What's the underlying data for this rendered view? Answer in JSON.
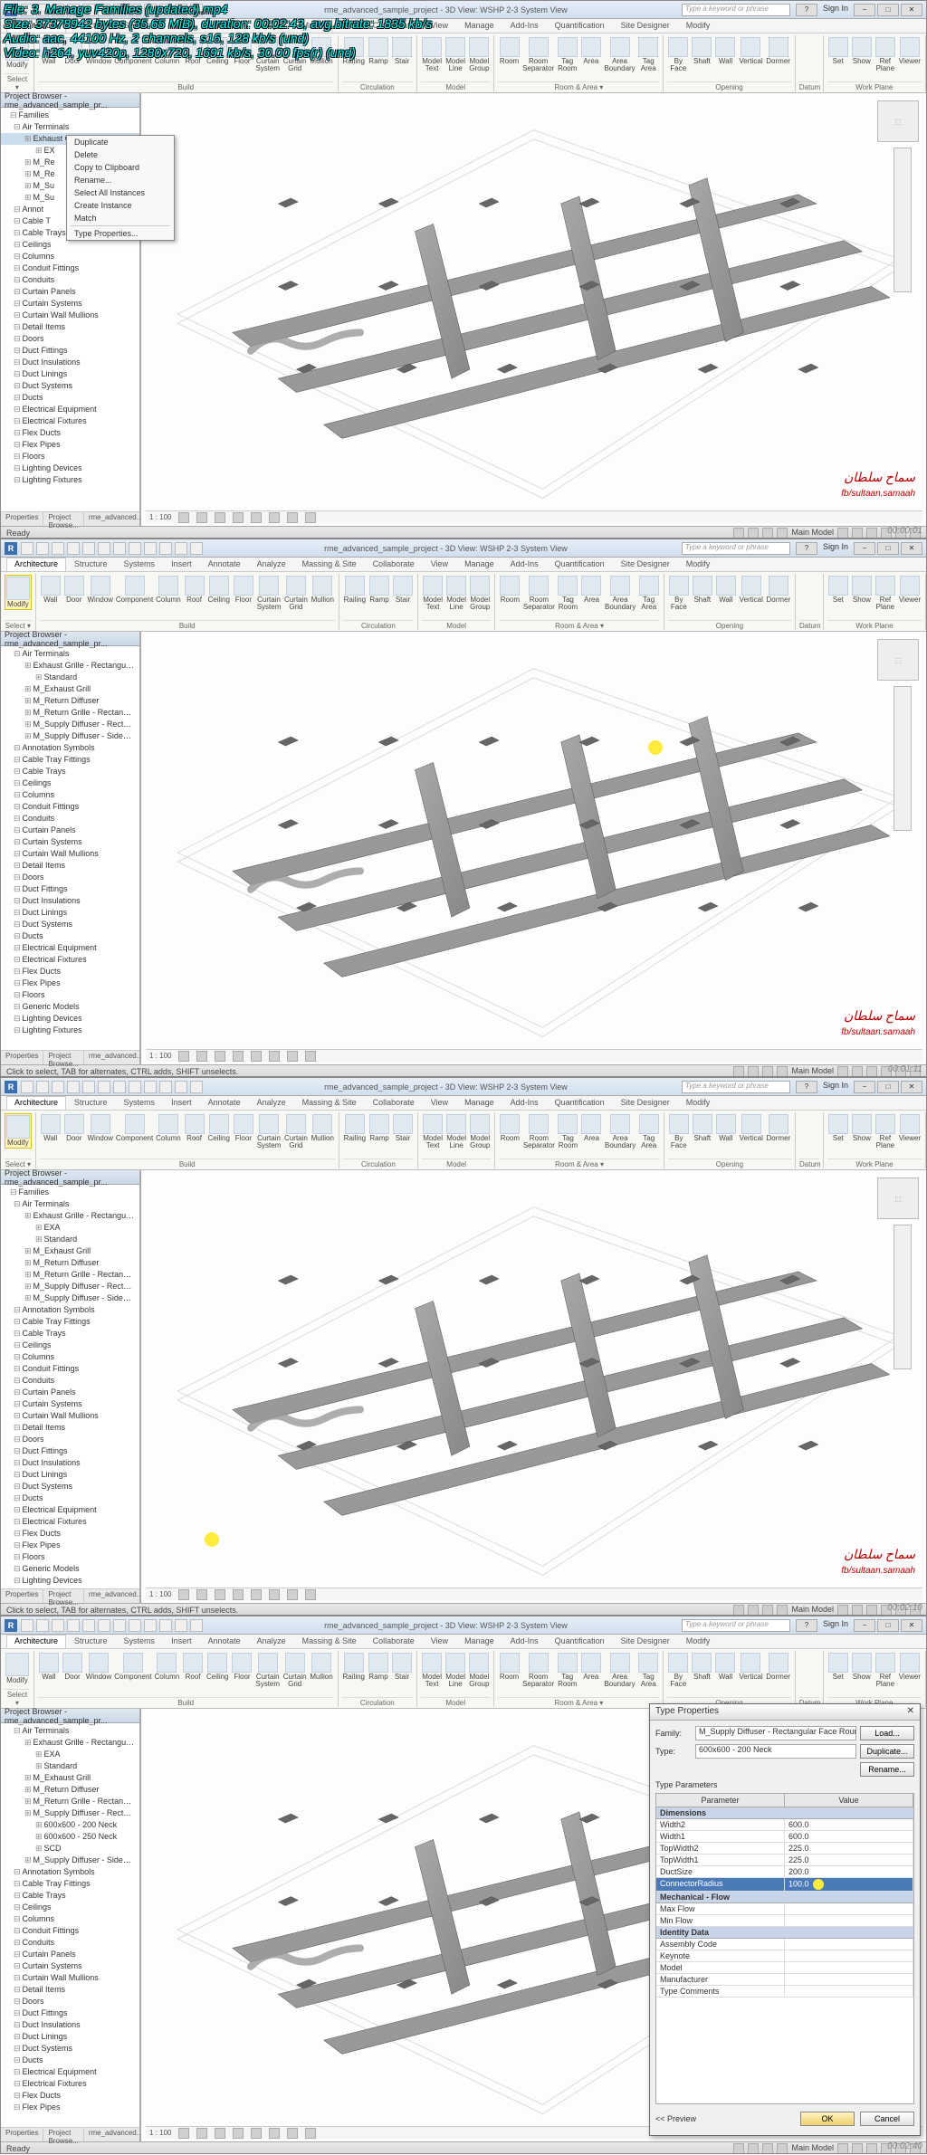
{
  "overlay": {
    "file": "File: 3. Manage Families (updated).mp4",
    "size": "Size: 37378942 bytes (35.65 MiB), duration: 00:02:43, avg.bitrate: 1835 kb/s",
    "audio": "Audio: aac, 44100 Hz, 2 channels, s16, 128 kb/s (und)",
    "video": "Video: h264, yuv420p, 1280x720, 1691 kb/s, 30.00 fps(r) (und)"
  },
  "title_text": "rme_advanced_sample_project - 3D View: WSHP 2-3 System View",
  "search_placeholder": "Type a keyword or phrase",
  "sign_in": "Sign In",
  "ribbon_tabs": [
    "Architecture",
    "Structure",
    "Systems",
    "Insert",
    "Annotate",
    "Analyze",
    "Massing & Site",
    "Collaborate",
    "View",
    "Manage",
    "Add-Ins",
    "Quantification",
    "Site Designer",
    "Modify"
  ],
  "ribbon_groups": {
    "select": {
      "label": "Select ▾",
      "items": [
        {
          "label": "Modify"
        }
      ]
    },
    "build": {
      "label": "Build",
      "items": [
        {
          "label": "Wall"
        },
        {
          "label": "Door"
        },
        {
          "label": "Window"
        },
        {
          "label": "Component"
        },
        {
          "label": "Column"
        },
        {
          "label": "Roof"
        },
        {
          "label": "Ceiling"
        },
        {
          "label": "Floor"
        },
        {
          "label": "Curtain\nSystem"
        },
        {
          "label": "Curtain\nGrid"
        },
        {
          "label": "Mullion"
        }
      ]
    },
    "circulation": {
      "label": "Circulation",
      "items": [
        {
          "label": "Railing"
        },
        {
          "label": "Ramp"
        },
        {
          "label": "Stair"
        }
      ]
    },
    "model": {
      "label": "Model",
      "items": [
        {
          "label": "Model\nText"
        },
        {
          "label": "Model\nLine"
        },
        {
          "label": "Model\nGroup"
        }
      ]
    },
    "room": {
      "label": "Room & Area ▾",
      "items": [
        {
          "label": "Room"
        },
        {
          "label": "Room\nSeparator"
        },
        {
          "label": "Tag\nRoom"
        },
        {
          "label": "Area"
        },
        {
          "label": "Area\nBoundary"
        },
        {
          "label": "Tag\nArea"
        }
      ]
    },
    "opening": {
      "label": "Opening",
      "items": [
        {
          "label": "By\nFace"
        },
        {
          "label": "Shaft"
        },
        {
          "label": "Wall"
        },
        {
          "label": "Vertical"
        },
        {
          "label": "Dormer"
        }
      ]
    },
    "datum": {
      "label": "Datum"
    },
    "workplane": {
      "label": "Work Plane",
      "items": [
        {
          "label": "Set"
        },
        {
          "label": "Show"
        },
        {
          "label": "Ref\nPlane"
        },
        {
          "label": "Viewer"
        }
      ]
    }
  },
  "project_browser_title": "Project Browser - rme_advanced_sample_pr...",
  "panel_tabs": [
    "Properties",
    "Project Browse...",
    "rme_advanced..."
  ],
  "tree1": [
    {
      "l": 0,
      "t": "Families"
    },
    {
      "l": 1,
      "t": "Air Terminals"
    },
    {
      "l": 2,
      "t": "Exhaust Grille - Rectangular - F",
      "sel": true
    },
    {
      "l": 3,
      "t": "EX"
    },
    {
      "l": 2,
      "t": "M_Re"
    },
    {
      "l": 2,
      "t": "M_Re"
    },
    {
      "l": 2,
      "t": "M_Su"
    },
    {
      "l": 2,
      "t": "M_Su"
    },
    {
      "l": 1,
      "t": "Annot"
    },
    {
      "l": 1,
      "t": "Cable T"
    },
    {
      "l": 1,
      "t": "Cable Trays"
    },
    {
      "l": 1,
      "t": "Ceilings"
    },
    {
      "l": 1,
      "t": "Columns"
    },
    {
      "l": 1,
      "t": "Conduit Fittings"
    },
    {
      "l": 1,
      "t": "Conduits"
    },
    {
      "l": 1,
      "t": "Curtain Panels"
    },
    {
      "l": 1,
      "t": "Curtain Systems"
    },
    {
      "l": 1,
      "t": "Curtain Wall Mullions"
    },
    {
      "l": 1,
      "t": "Detail Items"
    },
    {
      "l": 1,
      "t": "Doors"
    },
    {
      "l": 1,
      "t": "Duct Fittings"
    },
    {
      "l": 1,
      "t": "Duct Insulations"
    },
    {
      "l": 1,
      "t": "Duct Linings"
    },
    {
      "l": 1,
      "t": "Duct Systems"
    },
    {
      "l": 1,
      "t": "Ducts"
    },
    {
      "l": 1,
      "t": "Electrical Equipment"
    },
    {
      "l": 1,
      "t": "Electrical Fixtures"
    },
    {
      "l": 1,
      "t": "Flex Ducts"
    },
    {
      "l": 1,
      "t": "Flex Pipes"
    },
    {
      "l": 1,
      "t": "Floors"
    },
    {
      "l": 1,
      "t": "Lighting Devices"
    },
    {
      "l": 1,
      "t": "Lighting Fixtures"
    }
  ],
  "tree2": [
    {
      "l": 1,
      "t": "Air Terminals"
    },
    {
      "l": 2,
      "t": "Exhaust Grille - Rectangular - F"
    },
    {
      "l": 3,
      "t": "Standard"
    },
    {
      "l": 2,
      "t": "M_Exhaust Grill"
    },
    {
      "l": 2,
      "t": "M_Return Diffuser"
    },
    {
      "l": 2,
      "t": "M_Return Grille - Rectangular -"
    },
    {
      "l": 2,
      "t": "M_Supply Diffuser - Rectangul"
    },
    {
      "l": 2,
      "t": "M_Supply Diffuser - Sidewall"
    },
    {
      "l": 1,
      "t": "Annotation Symbols"
    },
    {
      "l": 1,
      "t": "Cable Tray Fittings"
    },
    {
      "l": 1,
      "t": "Cable Trays"
    },
    {
      "l": 1,
      "t": "Ceilings"
    },
    {
      "l": 1,
      "t": "Columns"
    },
    {
      "l": 1,
      "t": "Conduit Fittings"
    },
    {
      "l": 1,
      "t": "Conduits"
    },
    {
      "l": 1,
      "t": "Curtain Panels"
    },
    {
      "l": 1,
      "t": "Curtain Systems"
    },
    {
      "l": 1,
      "t": "Curtain Wall Mullions"
    },
    {
      "l": 1,
      "t": "Detail Items"
    },
    {
      "l": 1,
      "t": "Doors"
    },
    {
      "l": 1,
      "t": "Duct Fittings"
    },
    {
      "l": 1,
      "t": "Duct Insulations"
    },
    {
      "l": 1,
      "t": "Duct Linings"
    },
    {
      "l": 1,
      "t": "Duct Systems"
    },
    {
      "l": 1,
      "t": "Ducts"
    },
    {
      "l": 1,
      "t": "Electrical Equipment"
    },
    {
      "l": 1,
      "t": "Electrical Fixtures"
    },
    {
      "l": 1,
      "t": "Flex Ducts"
    },
    {
      "l": 1,
      "t": "Flex Pipes"
    },
    {
      "l": 1,
      "t": "Floors"
    },
    {
      "l": 1,
      "t": "Generic Models"
    },
    {
      "l": 1,
      "t": "Lighting Devices"
    },
    {
      "l": 1,
      "t": "Lighting Fixtures"
    }
  ],
  "tree3": [
    {
      "l": 0,
      "t": "Families"
    },
    {
      "l": 1,
      "t": "Air Terminals"
    },
    {
      "l": 2,
      "t": "Exhaust Grille - Rectangular - F"
    },
    {
      "l": 3,
      "t": "EXA"
    },
    {
      "l": 3,
      "t": "Standard"
    },
    {
      "l": 2,
      "t": "M_Exhaust Grill"
    },
    {
      "l": 2,
      "t": "M_Return Diffuser"
    },
    {
      "l": 2,
      "t": "M_Return Grille - Rectangular"
    },
    {
      "l": 2,
      "t": "M_Supply Diffuser - Rectangul"
    },
    {
      "l": 2,
      "t": "M_Supply Diffuser - Sidewall"
    },
    {
      "l": 1,
      "t": "Annotation Symbols"
    },
    {
      "l": 1,
      "t": "Cable Tray Fittings"
    },
    {
      "l": 1,
      "t": "Cable Trays"
    },
    {
      "l": 1,
      "t": "Ceilings"
    },
    {
      "l": 1,
      "t": "Columns"
    },
    {
      "l": 1,
      "t": "Conduit Fittings"
    },
    {
      "l": 1,
      "t": "Conduits"
    },
    {
      "l": 1,
      "t": "Curtain Panels"
    },
    {
      "l": 1,
      "t": "Curtain Systems"
    },
    {
      "l": 1,
      "t": "Curtain Wall Mullions"
    },
    {
      "l": 1,
      "t": "Detail Items"
    },
    {
      "l": 1,
      "t": "Doors"
    },
    {
      "l": 1,
      "t": "Duct Fittings"
    },
    {
      "l": 1,
      "t": "Duct Insulations"
    },
    {
      "l": 1,
      "t": "Duct Linings"
    },
    {
      "l": 1,
      "t": "Duct Systems"
    },
    {
      "l": 1,
      "t": "Ducts"
    },
    {
      "l": 1,
      "t": "Electrical Equipment"
    },
    {
      "l": 1,
      "t": "Electrical Fixtures"
    },
    {
      "l": 1,
      "t": "Flex Ducts"
    },
    {
      "l": 1,
      "t": "Flex Pipes"
    },
    {
      "l": 1,
      "t": "Floors"
    },
    {
      "l": 1,
      "t": "Generic Models"
    },
    {
      "l": 1,
      "t": "Lighting Devices"
    }
  ],
  "tree4": [
    {
      "l": 1,
      "t": "Air Terminals"
    },
    {
      "l": 2,
      "t": "Exhaust Grille - Rectangular - F"
    },
    {
      "l": 3,
      "t": "EXA"
    },
    {
      "l": 3,
      "t": "Standard"
    },
    {
      "l": 2,
      "t": "M_Exhaust Grill"
    },
    {
      "l": 2,
      "t": "M_Return Diffuser"
    },
    {
      "l": 2,
      "t": "M_Return Grille - Rectangular"
    },
    {
      "l": 2,
      "t": "M_Supply Diffuser - Rectangul"
    },
    {
      "l": 3,
      "t": "600x600 - 200 Neck"
    },
    {
      "l": 3,
      "t": "600x600 - 250 Neck"
    },
    {
      "l": 3,
      "t": "SCD"
    },
    {
      "l": 2,
      "t": "M_Supply Diffuser - Sidewall"
    },
    {
      "l": 1,
      "t": "Annotation Symbols"
    },
    {
      "l": 1,
      "t": "Cable Tray Fittings"
    },
    {
      "l": 1,
      "t": "Cable Trays"
    },
    {
      "l": 1,
      "t": "Ceilings"
    },
    {
      "l": 1,
      "t": "Columns"
    },
    {
      "l": 1,
      "t": "Conduit Fittings"
    },
    {
      "l": 1,
      "t": "Conduits"
    },
    {
      "l": 1,
      "t": "Curtain Panels"
    },
    {
      "l": 1,
      "t": "Curtain Systems"
    },
    {
      "l": 1,
      "t": "Curtain Wall Mullions"
    },
    {
      "l": 1,
      "t": "Detail Items"
    },
    {
      "l": 1,
      "t": "Doors"
    },
    {
      "l": 1,
      "t": "Duct Fittings"
    },
    {
      "l": 1,
      "t": "Duct Insulations"
    },
    {
      "l": 1,
      "t": "Duct Linings"
    },
    {
      "l": 1,
      "t": "Duct Systems"
    },
    {
      "l": 1,
      "t": "Ducts"
    },
    {
      "l": 1,
      "t": "Electrical Equipment"
    },
    {
      "l": 1,
      "t": "Electrical Fixtures"
    },
    {
      "l": 1,
      "t": "Flex Ducts"
    },
    {
      "l": 1,
      "t": "Flex Pipes"
    }
  ],
  "context_menu": [
    "Duplicate",
    "Delete",
    "Copy to Clipboard",
    "Rename...",
    "Select All Instances",
    "Create Instance",
    "Match",
    "—",
    "Type Properties..."
  ],
  "scale_label": "1 : 100",
  "status_ready": "Ready",
  "status_click": "Click to select, TAB for alternates, CTRL adds, SHIFT unselects.",
  "main_model": "Main Model",
  "watermark1": "سماح سلطان",
  "watermark2": "fb/sultaan.samaah",
  "timestamps": [
    "00:00:01",
    "00:01:11",
    "00:02:10",
    "00:02:40"
  ],
  "type_props": {
    "title": "Type Properties",
    "family_label": "Family:",
    "family_value": "M_Supply Diffuser - Rectangular Face Round Neck",
    "type_label": "Type:",
    "type_value": "600x600 - 200 Neck",
    "load": "Load...",
    "duplicate": "Duplicate...",
    "rename": "Rename...",
    "type_params_label": "Type Parameters",
    "col_param": "Parameter",
    "col_value": "Value",
    "sections": [
      {
        "name": "Dimensions",
        "rows": [
          {
            "p": "Width2",
            "v": "600.0"
          },
          {
            "p": "Width1",
            "v": "600.0"
          },
          {
            "p": "TopWidth2",
            "v": "225.0"
          },
          {
            "p": "TopWidth1",
            "v": "225.0"
          },
          {
            "p": "DuctSize",
            "v": "200.0"
          },
          {
            "p": "ConnectorRadius",
            "v": "100.0",
            "hl": true
          }
        ]
      },
      {
        "name": "Mechanical - Flow",
        "rows": [
          {
            "p": "Max Flow",
            "v": ""
          },
          {
            "p": "Min Flow",
            "v": ""
          }
        ]
      },
      {
        "name": "Identity Data",
        "rows": [
          {
            "p": "Assembly Code",
            "v": ""
          },
          {
            "p": "Keynote",
            "v": ""
          },
          {
            "p": "Model",
            "v": ""
          },
          {
            "p": "Manufacturer",
            "v": ""
          },
          {
            "p": "Type Comments",
            "v": ""
          }
        ]
      }
    ],
    "preview": "<< Preview",
    "ok": "OK",
    "cancel": "Cancel"
  }
}
